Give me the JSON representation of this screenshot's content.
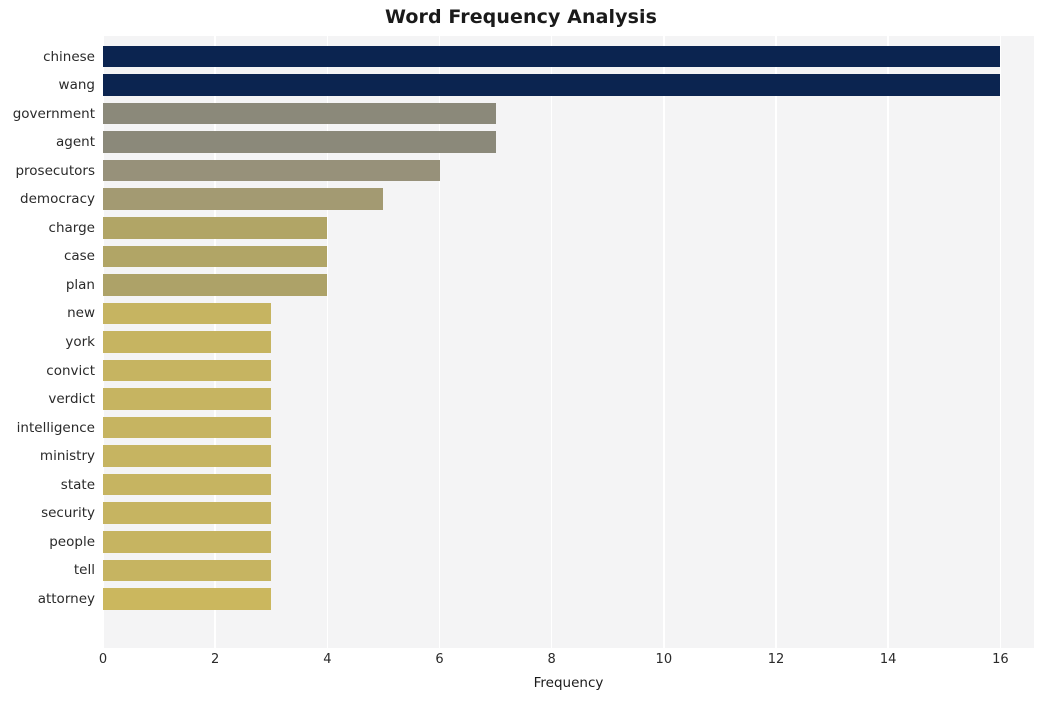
{
  "chart_data": {
    "type": "bar",
    "orientation": "horizontal",
    "title": "Word Frequency Analysis",
    "xlabel": "Frequency",
    "ylabel": "",
    "categories": [
      "chinese",
      "wang",
      "government",
      "agent",
      "prosecutors",
      "democracy",
      "charge",
      "case",
      "plan",
      "new",
      "york",
      "convict",
      "verdict",
      "intelligence",
      "ministry",
      "state",
      "security",
      "people",
      "tell",
      "attorney"
    ],
    "values": [
      16,
      16,
      7,
      7,
      6,
      5,
      4,
      4,
      4,
      3,
      3,
      3,
      3,
      3,
      3,
      3,
      3,
      3,
      3,
      3
    ],
    "bar_colors": [
      "#0b2450",
      "#0b2450",
      "#8b897a",
      "#8b897a",
      "#97917a",
      "#a39a72",
      "#b1a566",
      "#b1a566",
      "#ada268",
      "#c6b461",
      "#c6b461",
      "#c6b461",
      "#c6b461",
      "#c6b461",
      "#c6b461",
      "#c6b461",
      "#c6b461",
      "#c6b461",
      "#c6b461",
      "#cbb75e"
    ],
    "xlim": [
      0,
      16.6
    ],
    "xticks": [
      0,
      2,
      4,
      6,
      8,
      10,
      12,
      14,
      16
    ],
    "xtick_labels": [
      "0",
      "2",
      "4",
      "6",
      "8",
      "10",
      "12",
      "14",
      "16"
    ],
    "grid": true,
    "grid_axis": "x",
    "grid_color": "#ffffff",
    "plot_background": "#f4f4f5",
    "figure_background": "#ffffff",
    "legend": null,
    "style": "whitegrid"
  }
}
